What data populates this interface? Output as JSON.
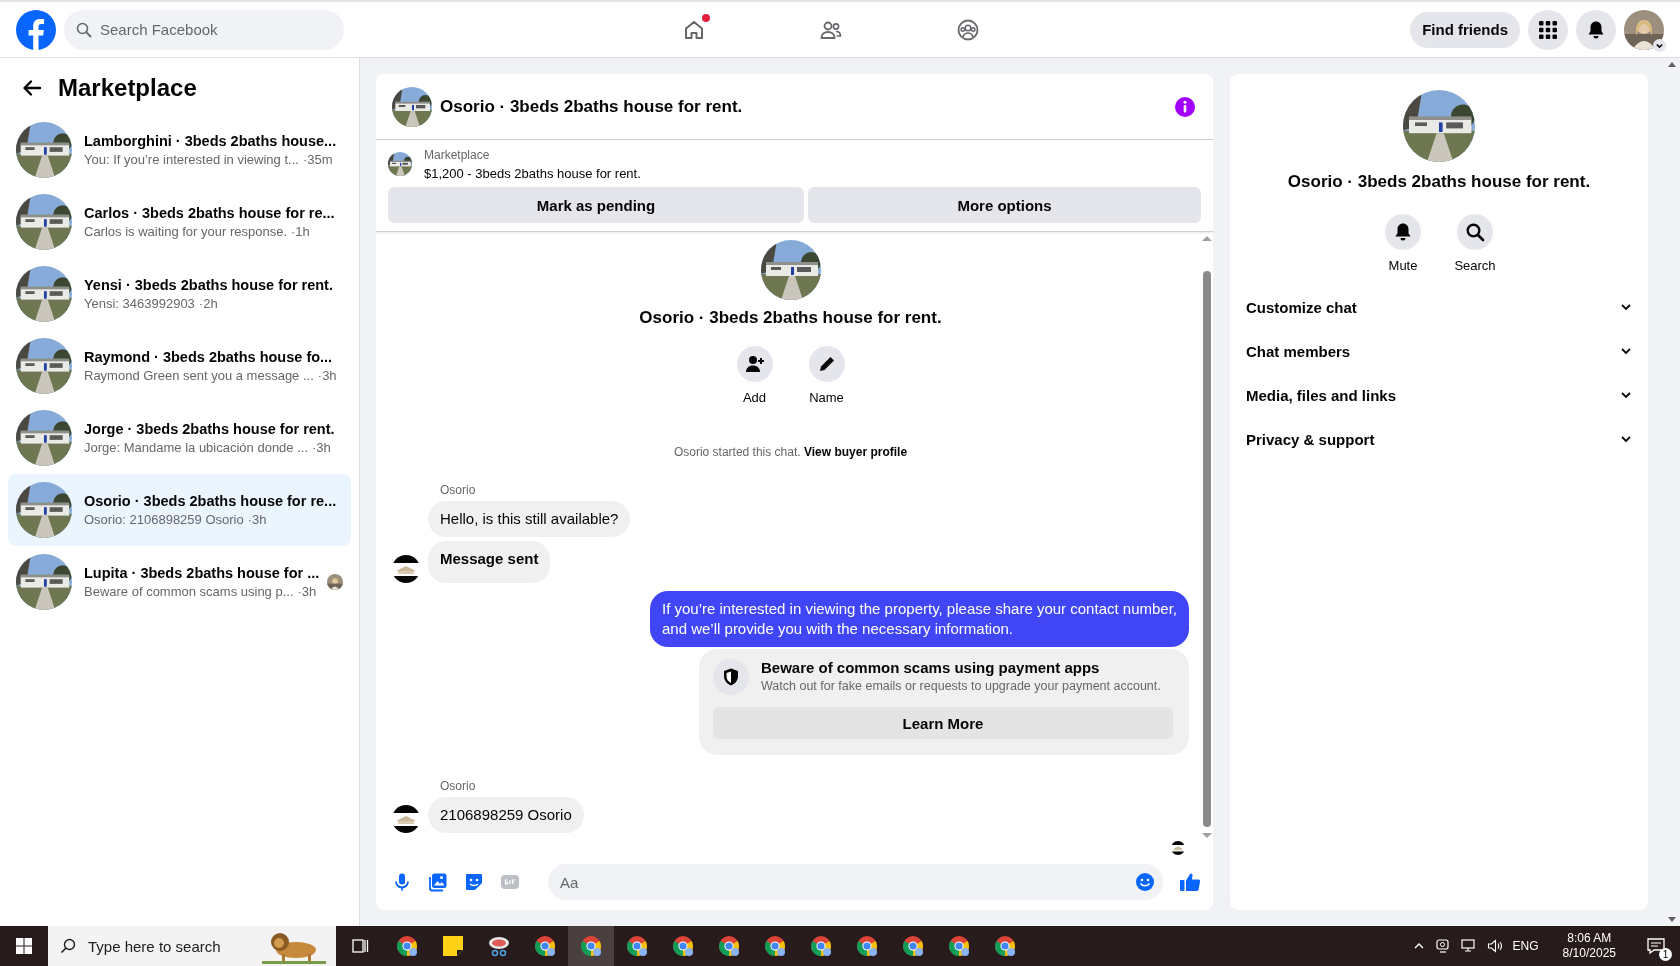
{
  "topbar": {
    "search_placeholder": "Search Facebook",
    "nav": [
      {
        "kind": "home",
        "selected": false,
        "dot": true
      },
      {
        "kind": "friends",
        "selected": false,
        "dot": false
      },
      {
        "kind": "groups",
        "selected": false,
        "dot": false
      }
    ],
    "find_friends": "Find friends"
  },
  "sidebar": {
    "title": "Marketplace",
    "conversations": [
      {
        "title": "Lamborghini · 3beds 2baths house...",
        "snippet": "You: If you’re interested in viewing t...",
        "time": "·35m",
        "selected": false,
        "seen": false
      },
      {
        "title": "Carlos · 3beds 2baths house for re...",
        "snippet": "Carlos is waiting for your response.",
        "time": "·1h",
        "selected": false,
        "seen": false
      },
      {
        "title": "Yensi · 3beds 2baths house for rent.",
        "snippet": "Yensi: 3463992903",
        "time": "·2h",
        "selected": false,
        "seen": false
      },
      {
        "title": "Raymond · 3beds 2baths house fo...",
        "snippet": "Raymond Green sent you a message ...",
        "time": "·3h",
        "selected": false,
        "seen": false
      },
      {
        "title": "Jorge · 3beds 2baths house for rent.",
        "snippet": "Jorge: Mandame la ubicación donde ...",
        "time": "·3h",
        "selected": false,
        "seen": false
      },
      {
        "title": "Osorio · 3beds 2baths house for re...",
        "snippet": "Osorio: 2106898259 Osorio",
        "time": "·3h",
        "selected": true,
        "seen": false
      },
      {
        "title": "Lupita · 3beds 2baths house for ...",
        "snippet": "Beware of common scams using p...",
        "time": "·3h",
        "selected": false,
        "seen": true
      }
    ]
  },
  "chat": {
    "title": "Osorio · 3beds 2baths house for rent.",
    "listing": {
      "label": "Marketplace",
      "text": "$1,200 - 3beds 2baths house for rent."
    },
    "actions": [
      "Mark as pending",
      "More options"
    ],
    "intro": {
      "title": "Osorio · 3beds 2baths house for rent.",
      "buttons": [
        {
          "kind": "add",
          "label": "Add"
        },
        {
          "kind": "edit",
          "label": "Name"
        }
      ],
      "started": "Osorio started this chat.",
      "link": "View buyer profile"
    },
    "messages": [
      {
        "kind": "incoming",
        "sender": "Osorio",
        "bubbles": [
          {
            "text": "Hello, is this still available?",
            "bold": false
          },
          {
            "text": "Message sent",
            "bold": true
          }
        ]
      },
      {
        "kind": "outgoing",
        "bubbles": [
          {
            "text": "If you’re interested in viewing the property, please share your contact number, and we’ll provide you with the necessary information.",
            "bold": false
          }
        ]
      },
      {
        "kind": "notice",
        "title": "Beware of common scams using payment apps",
        "text": "Watch out for fake emails or requests to upgrade your payment account.",
        "button": "Learn More"
      },
      {
        "kind": "incoming",
        "sender": "Osorio",
        "bubbles": [
          {
            "text": "2106898259 Osorio",
            "bold": false
          }
        ]
      }
    ],
    "composer": {
      "placeholder": "Aa"
    }
  },
  "details": {
    "title": "Osorio · 3beds 2baths house for rent.",
    "buttons": [
      {
        "kind": "mute",
        "label": "Mute"
      },
      {
        "kind": "search",
        "label": "Search"
      }
    ],
    "sections": [
      {
        "label": "Customize chat",
        "expanded": false
      },
      {
        "label": "Chat members",
        "expanded": false
      },
      {
        "label": "Media, files and links",
        "expanded": false
      },
      {
        "label": "Privacy & support",
        "expanded": false
      }
    ]
  },
  "taskbar": {
    "search_placeholder": "Type here to search",
    "apps": [
      {
        "kind": "chrome",
        "selected": false
      },
      {
        "kind": "notes",
        "selected": false
      },
      {
        "kind": "snip",
        "selected": false
      },
      {
        "kind": "chrome",
        "selected": false
      },
      {
        "kind": "chrome",
        "selected": true
      },
      {
        "kind": "chrome",
        "selected": false
      },
      {
        "kind": "chrome",
        "selected": false
      },
      {
        "kind": "chrome",
        "selected": false
      },
      {
        "kind": "chrome",
        "selected": false
      },
      {
        "kind": "chrome",
        "selected": false
      },
      {
        "kind": "chrome",
        "selected": false
      },
      {
        "kind": "chrome",
        "selected": false
      },
      {
        "kind": "chrome",
        "selected": false
      },
      {
        "kind": "chrome",
        "selected": false
      }
    ],
    "language": "ENG",
    "time": "8:06 AM",
    "date": "8/10/2025",
    "notifications": "1"
  }
}
